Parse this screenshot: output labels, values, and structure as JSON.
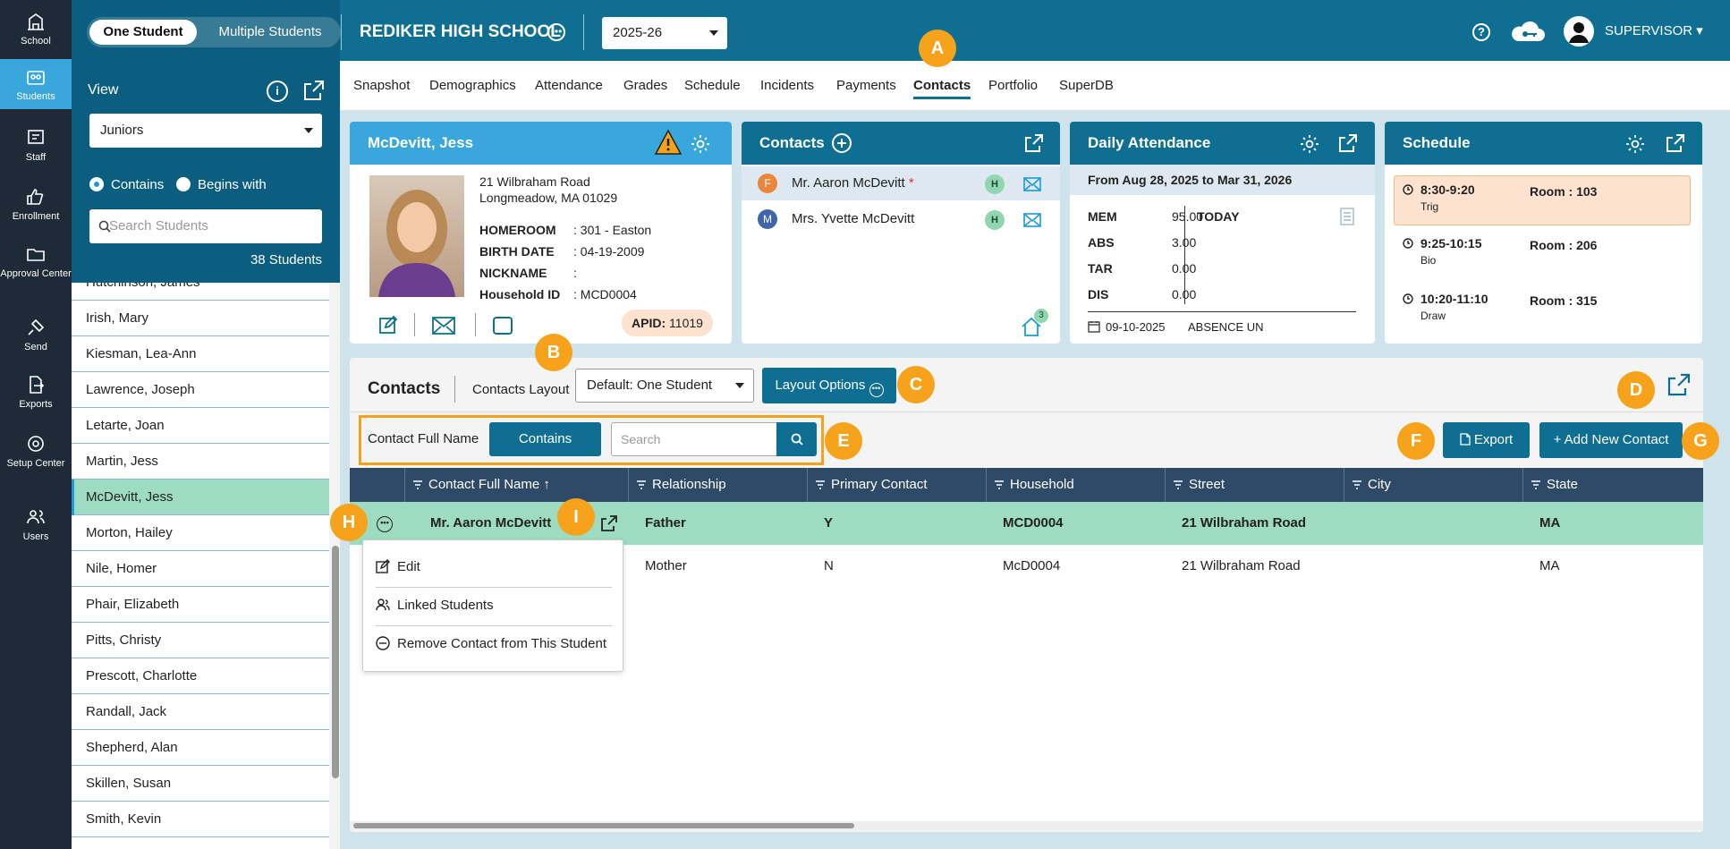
{
  "rail": {
    "items": [
      {
        "label": "School",
        "icon": "school-icon"
      },
      {
        "label": "Students",
        "icon": "students-icon"
      },
      {
        "label": "Staff",
        "icon": "staff-icon"
      },
      {
        "label": "Enrollment",
        "icon": "enrollment-icon"
      },
      {
        "label": "Approval Center",
        "icon": "approval-icon"
      },
      {
        "label": "Send",
        "icon": "send-icon"
      },
      {
        "label": "Exports",
        "icon": "exports-icon"
      },
      {
        "label": "Setup Center",
        "icon": "setup-icon"
      },
      {
        "label": "Users",
        "icon": "users-icon"
      }
    ]
  },
  "topbar": {
    "toggle_one": "One Student",
    "toggle_multi": "Multiple Students",
    "school": "REDIKER HIGH SCHOOL",
    "year": "2025-26",
    "help": "?",
    "user": "SUPERVISOR ▾"
  },
  "sidebar": {
    "view_label": "View",
    "info": "i",
    "view_value": "Juniors",
    "radio_contains": "Contains",
    "radio_begins": "Begins with",
    "search_placeholder": "Search Students",
    "count": "38 Students",
    "students": [
      "Hutchinson, James",
      "Irish, Mary",
      "Kiesman, Lea-Ann",
      "Lawrence, Joseph",
      "Letarte, Joan",
      "Martin, Jess",
      "McDevitt, Jess",
      "Morton, Hailey",
      "Nile, Homer",
      "Phair, Elizabeth",
      "Pitts, Christy",
      "Prescott, Charlotte",
      "Randall, Jack",
      "Shepherd, Alan",
      "Skillen, Susan",
      "Smith, Kevin"
    ],
    "selected": "McDevitt, Jess"
  },
  "tabs": [
    "Snapshot",
    "Demographics",
    "Attendance",
    "Grades",
    "Schedule",
    "Incidents",
    "Payments",
    "Contacts",
    "Portfolio",
    "SuperDB"
  ],
  "active_tab": "Contacts",
  "student_card": {
    "name": "McDevitt, Jess",
    "address1": "21 Wilbraham Road",
    "address2": "Longmeadow, MA 01029",
    "fields": [
      {
        "k": "HOMEROOM",
        "v": ": 301 - Easton"
      },
      {
        "k": "BIRTH DATE",
        "v": ": 04-19-2009"
      },
      {
        "k": "NICKNAME",
        "v": ":"
      },
      {
        "k": "Household ID",
        "v": ": MCD0004"
      }
    ],
    "apid_label": "APID:",
    "apid_value": "11019"
  },
  "contacts_card": {
    "title": "Contacts",
    "items": [
      {
        "initial": "F",
        "name": "Mr. Aaron McDevitt",
        "required": "*",
        "tag": "H",
        "color": "#e8873a"
      },
      {
        "initial": "M",
        "name": "Mrs. Yvette McDevitt",
        "required": "",
        "tag": "H",
        "color": "#3f66a8"
      }
    ],
    "home_count": "3"
  },
  "attendance_card": {
    "title": "Daily Attendance",
    "range": "From Aug 28, 2025 to Mar 31, 2026",
    "stats": [
      {
        "k": "MEM",
        "v": "95.00"
      },
      {
        "k": "ABS",
        "v": "3.00"
      },
      {
        "k": "TAR",
        "v": "0.00"
      },
      {
        "k": "DIS",
        "v": "0.00"
      }
    ],
    "today": "TODAY",
    "date": "09-10-2025",
    "status": "ABSENCE UN"
  },
  "schedule_card": {
    "title": "Schedule",
    "items": [
      {
        "time": "8:30-9:20",
        "course": "Trig",
        "room": "Room : 103"
      },
      {
        "time": "9:25-10:15",
        "course": "Bio",
        "room": "Room : 206"
      },
      {
        "time": "10:20-11:10",
        "course": "Draw",
        "room": "Room : 315"
      }
    ]
  },
  "grid": {
    "title": "Contacts",
    "layout_label": "Contacts Layout",
    "layout_value": "Default: One Student",
    "layout_options": "Layout Options",
    "filter_label": "Contact Full Name",
    "filter_mode": "Contains",
    "search_placeholder": "Search",
    "export": "Export",
    "add": "+ Add New Contact",
    "columns": [
      "Contact Full Name ↑",
      "Relationship",
      "Primary Contact",
      "Household",
      "Street",
      "City",
      "State"
    ],
    "rows": [
      {
        "name": "Mr. Aaron McDevitt",
        "relationship": "Father",
        "primary": "Y",
        "household": "MCD0004",
        "street": "21 Wilbraham Road",
        "city": "",
        "state": "MA"
      },
      {
        "name": "",
        "relationship": "Mother",
        "primary": "N",
        "household": "McD0004",
        "street": "21 Wilbraham Road",
        "city": "",
        "state": "MA"
      }
    ]
  },
  "context_menu": {
    "edit": "Edit",
    "linked": "Linked Students",
    "remove": "Remove Contact from This Student"
  },
  "callouts": [
    "A",
    "B",
    "C",
    "D",
    "E",
    "F",
    "G",
    "H",
    "I"
  ],
  "colors": {
    "accent": "#0e6f93",
    "highlight": "#f7a21b",
    "selected_row": "#9ddcc1"
  }
}
